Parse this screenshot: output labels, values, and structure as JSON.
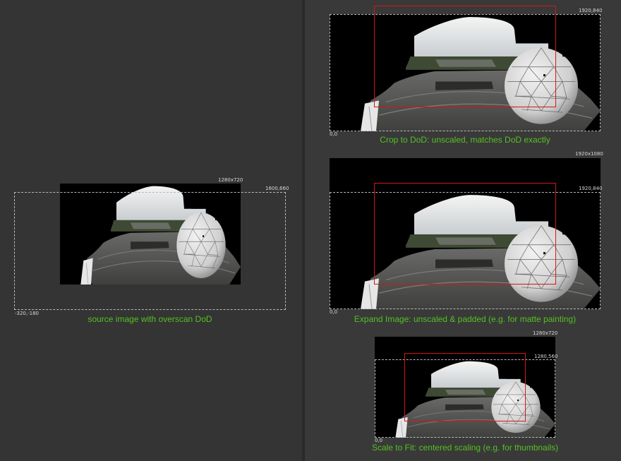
{
  "figures": {
    "source": {
      "caption": "source image with overscan DoD",
      "format_label": "1280x720",
      "dod_top_right": "1600,660",
      "dod_bottom_left": "-320,-180"
    },
    "crop": {
      "caption": "Crop to DoD: unscaled, matches DoD exactly",
      "dod_top_right": "1920,840",
      "origin": "0,0"
    },
    "expand": {
      "caption": "Expand Image: unscaled & padded (e.g. for matte painting)",
      "format_label": "1920x1080",
      "dod_top_right": "1920,840",
      "origin": "0,0"
    },
    "scale": {
      "caption": "Scale to Fit: centered scaling (e.g. for thumbnails)",
      "format_label": "1280x720",
      "dod_top_right": "1280,560",
      "origin": "0,0"
    }
  },
  "colors": {
    "caption_green": "#55c021",
    "format_box_red": "#d01818",
    "dod_dashed": "#b9b9b9"
  }
}
